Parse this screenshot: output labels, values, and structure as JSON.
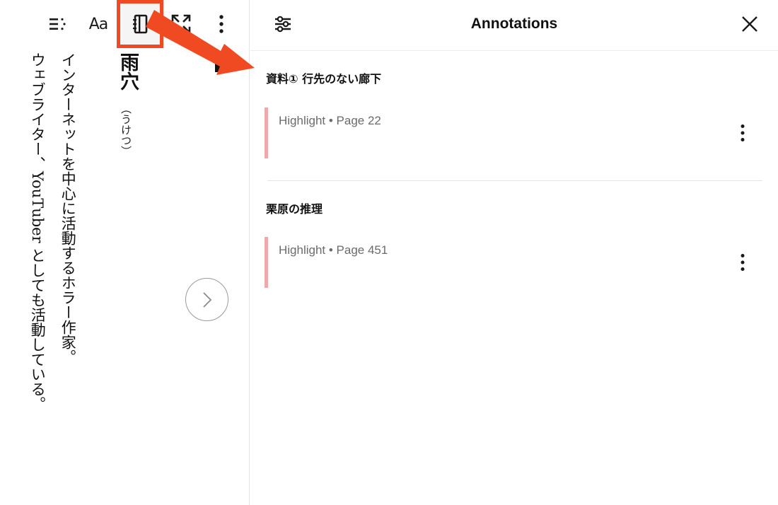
{
  "toolbar": {
    "font_button_label": "Aa",
    "icons": [
      "table-of-contents-icon",
      "notebook-icon",
      "fullscreen-icon",
      "more-vertical-icon"
    ],
    "highlight_color": "#f04a22"
  },
  "reader": {
    "title": "雨穴",
    "ruby": "（うけつ）",
    "body_lines": [
      "インターネットを中心に活動するホラー作家。",
      "ウェブライター、YouTuber としても活動している。"
    ]
  },
  "panel": {
    "title": "Annotations",
    "annotations": [
      {
        "chapter": "資料① 行先のない廊下",
        "meta": "Highlight • Page 22",
        "color": "#f0a8a8"
      },
      {
        "chapter": "栗原の推理",
        "meta": "Highlight • Page 451",
        "color": "#f0a8a8"
      }
    ]
  }
}
